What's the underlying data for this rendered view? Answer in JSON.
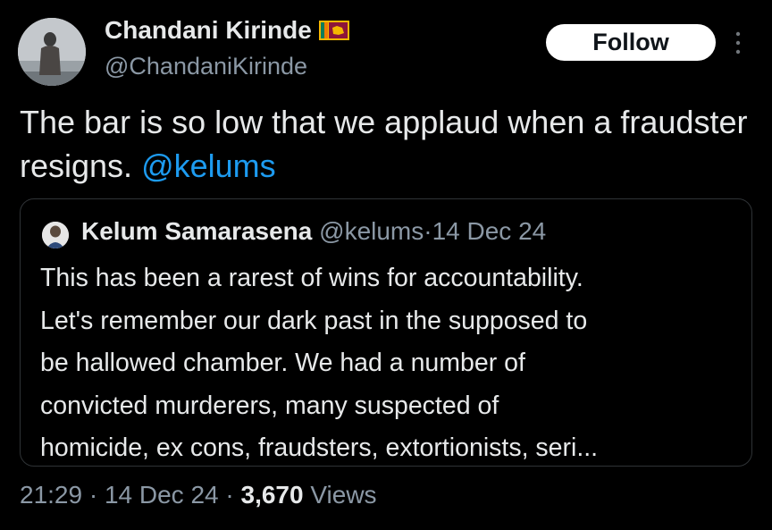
{
  "author": {
    "name": "Chandani Kirinde",
    "handle": "@ChandaniKirinde",
    "flag_icon": "sri-lanka-flag-icon"
  },
  "follow_button": {
    "label": "Follow"
  },
  "more_icon": "more-vertical-icon",
  "tweet": {
    "text_before_mention": "The bar is so low that we applaud when a fraudster resigns. ",
    "mention": "@kelums"
  },
  "quoted_tweet": {
    "author_name": "Kelum Samarasena",
    "author_handle": "@kelums",
    "separator": "·",
    "date": "14 Dec 24",
    "lines": [
      "This has been a rarest of wins for accountability.",
      "Let's remember our dark past in the supposed to",
      "be hallowed chamber. We had a number of",
      "convicted murderers, many suspected of",
      "homicide, ex cons, fraudsters, extortionists, seri..."
    ]
  },
  "footer": {
    "time": "21:29",
    "separator": "·",
    "date": "14 Dec 24",
    "views_count": "3,670",
    "views_label": "Views"
  },
  "colors": {
    "background": "#000000",
    "primary_text": "#e7e9ea",
    "secondary_text": "#8b98a5",
    "link": "#1d9bf0",
    "border": "#2f3336"
  }
}
